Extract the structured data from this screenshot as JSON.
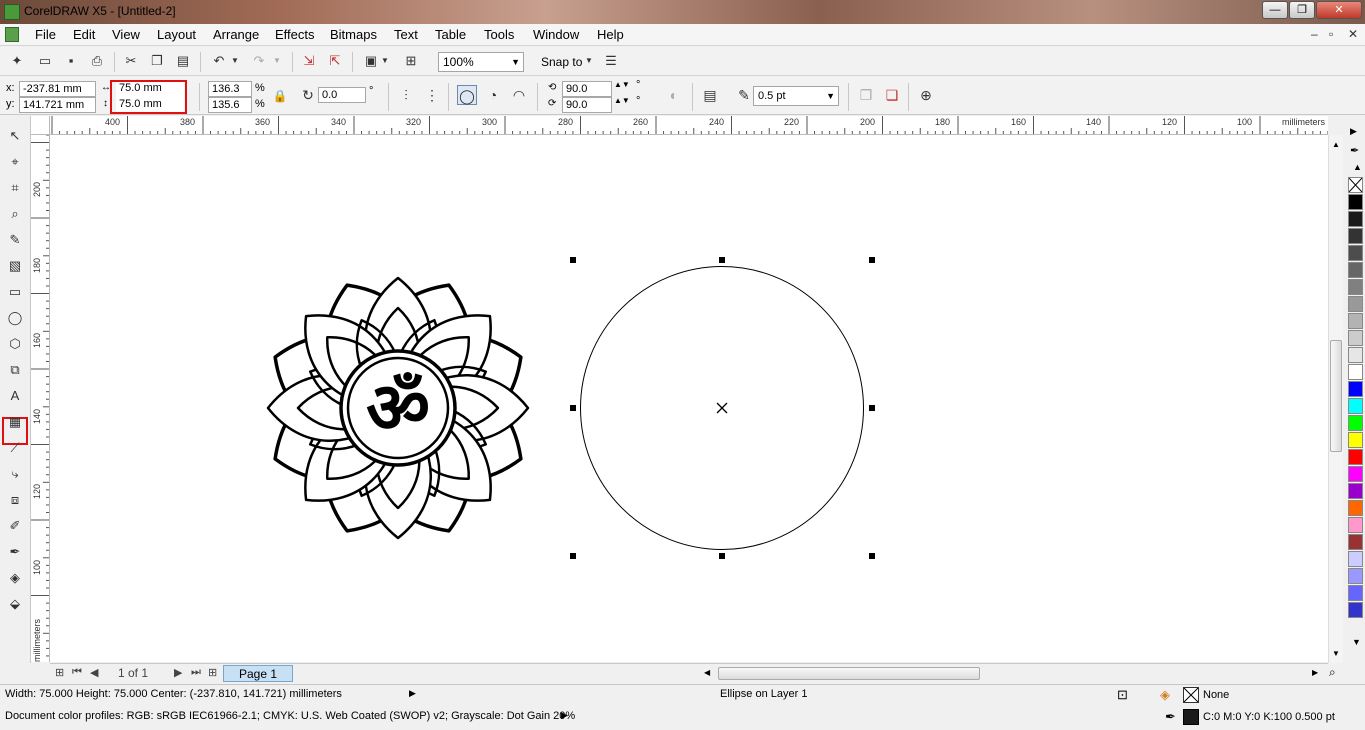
{
  "window": {
    "title": "CorelDRAW X5 - [Untitled-2]",
    "minimize": "—",
    "restore": "❐",
    "close": "✕"
  },
  "menu": {
    "items": [
      {
        "label": "File"
      },
      {
        "label": "Edit"
      },
      {
        "label": "View"
      },
      {
        "label": "Layout"
      },
      {
        "label": "Arrange"
      },
      {
        "label": "Effects"
      },
      {
        "label": "Bitmaps"
      },
      {
        "label": "Text"
      },
      {
        "label": "Table"
      },
      {
        "label": "Tools"
      },
      {
        "label": "Window"
      },
      {
        "label": "Help"
      }
    ],
    "mdi_controls": [
      "–",
      "▫",
      "✕"
    ]
  },
  "standard_toolbar": {
    "zoom_level": "100%",
    "snap_to": "Snap to"
  },
  "property_bar": {
    "x_label": "x:",
    "x_value": "-237.81 mm",
    "y_label": "y:",
    "y_value": "141.721 mm",
    "width_value": "75.0 mm",
    "height_value": "75.0 mm",
    "scale_x": "136.3",
    "scale_y": "135.6",
    "percent": "%",
    "rotation": "0.0",
    "degree": "°",
    "start_angle": "90.0",
    "end_angle": "90.0",
    "outline_width": "0.5 pt"
  },
  "rulers": {
    "unit": "millimeters",
    "h_labels": [
      "400",
      "380",
      "360",
      "340",
      "320",
      "300",
      "280",
      "260",
      "240",
      "220",
      "200",
      "180",
      "160",
      "140",
      "120",
      "100"
    ],
    "v_labels": [
      "200",
      "180",
      "160",
      "140",
      "120",
      "100"
    ]
  },
  "page_nav": {
    "page_count": "1 of 1",
    "page_tab": "Page 1"
  },
  "palette": {
    "colors": [
      "#000000",
      "#1a1a1a",
      "#333333",
      "#4d4d4d",
      "#666666",
      "#808080",
      "#999999",
      "#b3b3b3",
      "#cccccc",
      "#e6e6e6",
      "#ffffff",
      "#0000ff",
      "#00ffff",
      "#00ff00",
      "#ffff00",
      "#ff0000",
      "#ff00ff",
      "#9900cc",
      "#ff6600",
      "#ff99cc",
      "#993333",
      "#ccccff",
      "#9999ff",
      "#6666ff",
      "#3333cc"
    ]
  },
  "status": {
    "dimensions": "Width: 75.000  Height: 75.000  Center: (-237.810, 141.721)  millimeters",
    "object_info": "Ellipse on Layer 1",
    "fill": "None",
    "color_profiles": "Document color profiles: RGB: sRGB IEC61966-2.1; CMYK: U.S. Web Coated (SWOP) v2; Grayscale: Dot Gain 20%",
    "outline": "C:0 M:0 Y:0 K:100  0.500 pt"
  }
}
